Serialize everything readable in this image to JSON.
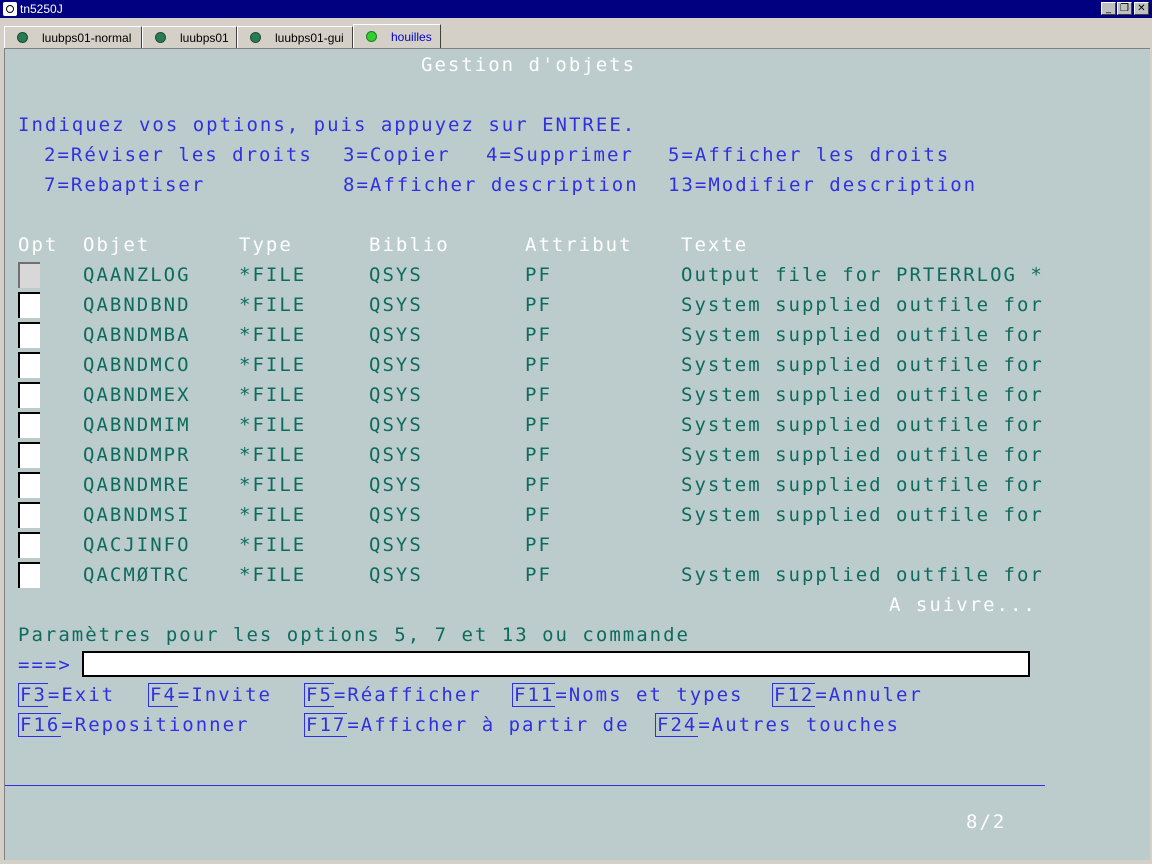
{
  "window": {
    "title": "tn5250J",
    "buttons": [
      "_",
      "❐",
      "✕"
    ]
  },
  "tabs": [
    {
      "label": "luubps01-normal",
      "active": false
    },
    {
      "label": "luubps01",
      "active": false
    },
    {
      "label": "luubps01-gui",
      "active": false
    },
    {
      "label": "houilles",
      "active": true
    }
  ],
  "screen": {
    "title": "Gestion d'objets",
    "instructions": "Indiquez vos options, puis appuyez sur ENTREE.",
    "options": {
      "opt2": "2=Réviser les droits",
      "opt3": "3=Copier",
      "opt4": "4=Supprimer",
      "opt5": "5=Afficher les droits",
      "opt7": "7=Rebaptiser",
      "opt8": "8=Afficher description",
      "opt13": "13=Modifier description"
    },
    "columns": {
      "opt": "Opt",
      "objet": "Objet",
      "type": "Type",
      "biblio": "Biblio",
      "attribut": "Attribut",
      "texte": "Texte"
    },
    "rows": [
      {
        "objet": "QAANZLOG",
        "type": "*FILE",
        "biblio": "QSYS",
        "attribut": "PF",
        "texte": "Output file for PRTERRLOG *"
      },
      {
        "objet": "QABNDBND",
        "type": "*FILE",
        "biblio": "QSYS",
        "attribut": "PF",
        "texte": "System supplied outfile for"
      },
      {
        "objet": "QABNDMBA",
        "type": "*FILE",
        "biblio": "QSYS",
        "attribut": "PF",
        "texte": "System supplied outfile for"
      },
      {
        "objet": "QABNDMCO",
        "type": "*FILE",
        "biblio": "QSYS",
        "attribut": "PF",
        "texte": "System supplied outfile for"
      },
      {
        "objet": "QABNDMEX",
        "type": "*FILE",
        "biblio": "QSYS",
        "attribut": "PF",
        "texte": "System supplied outfile for"
      },
      {
        "objet": "QABNDMIM",
        "type": "*FILE",
        "biblio": "QSYS",
        "attribut": "PF",
        "texte": "System supplied outfile for"
      },
      {
        "objet": "QABNDMPR",
        "type": "*FILE",
        "biblio": "QSYS",
        "attribut": "PF",
        "texte": "System supplied outfile for"
      },
      {
        "objet": "QABNDMRE",
        "type": "*FILE",
        "biblio": "QSYS",
        "attribut": "PF",
        "texte": "System supplied outfile for"
      },
      {
        "objet": "QABNDMSI",
        "type": "*FILE",
        "biblio": "QSYS",
        "attribut": "PF",
        "texte": "System supplied outfile for"
      },
      {
        "objet": "QACJINFO",
        "type": "*FILE",
        "biblio": "QSYS",
        "attribut": "PF",
        "texte": ""
      },
      {
        "objet": "QACMØTRC",
        "type": "*FILE",
        "biblio": "QSYS",
        "attribut": "PF",
        "texte": "System supplied outfile for"
      }
    ],
    "more": "A suivre...",
    "params_label": "Paramètres pour les options 5, 7 et 13 ou commande",
    "prompt": "===>",
    "command_value": "",
    "fkeys": {
      "f3": {
        "key": "F3",
        "label": "=Exit"
      },
      "f4": {
        "key": "F4",
        "label": "=Invite"
      },
      "f5": {
        "key": "F5",
        "label": "=Réafficher"
      },
      "f11": {
        "key": "F11",
        "label": "=Noms et types"
      },
      "f12": {
        "key": "F12",
        "label": "=Annuler"
      },
      "f16": {
        "key": "F16",
        "label": "=Repositionner"
      },
      "f17": {
        "key": "F17",
        "label": "=Afficher à partir de"
      },
      "f24": {
        "key": "F24",
        "label": "=Autres touches"
      }
    },
    "cursor_pos": "8/2"
  },
  "colors": {
    "screen_bg": "#bccccc",
    "field_blue": "#3030e0",
    "data_green": "#0d6b5e",
    "title_bar": "#000080"
  }
}
